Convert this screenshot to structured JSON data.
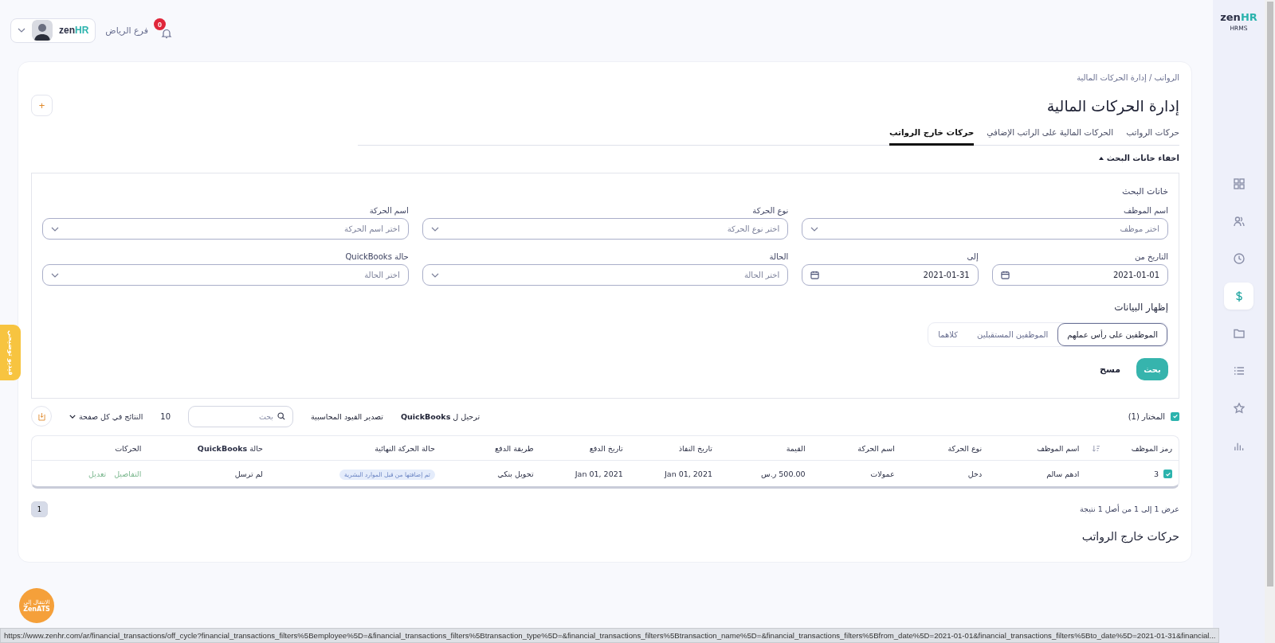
{
  "header": {
    "logo_zen": "zen",
    "logo_hr": "HR",
    "branch": "فرع الرياض",
    "notifications": "0"
  },
  "sidebar": {
    "logo_zen": "zen",
    "logo_hr": "HR",
    "product": "HRMS",
    "items": [
      {
        "kind": "grid",
        "selected": false
      },
      {
        "kind": "users",
        "selected": false
      },
      {
        "kind": "clock",
        "selected": false
      },
      {
        "kind": "dollar",
        "selected": true
      },
      {
        "kind": "folder",
        "selected": false
      },
      {
        "kind": "list",
        "selected": false
      },
      {
        "kind": "star",
        "selected": false
      },
      {
        "kind": "chart",
        "selected": false
      }
    ]
  },
  "breadcrumb": "الرواتب / إدارة الحركات المالية",
  "title": "إدارة الحركات المالية",
  "add_button": "+",
  "tabs": [
    {
      "label": "حركات الرواتب",
      "selected": false
    },
    {
      "label": "الحركات المالية على الراتب الإضافي",
      "selected": false
    },
    {
      "label": "حركات خارج الرواتب",
      "selected": true
    }
  ],
  "search_toggle": "اخفاء خانات البحث",
  "filters": {
    "title": "خانات البحث",
    "fields": [
      {
        "kind": "select",
        "label": "اسم الموظف",
        "placeholder": "اختر موظف"
      },
      {
        "kind": "select",
        "label": "نوع الحركة",
        "placeholder": "اختر نوع الحركة"
      },
      {
        "kind": "select",
        "label": "اسم الحركة",
        "placeholder": "اختر اسم الحركة"
      },
      {
        "kind": "date",
        "label": "التاريخ من",
        "value": "2021-01-01"
      },
      {
        "kind": "date",
        "label": "إلى",
        "value": "2021-01-31"
      },
      {
        "kind": "select",
        "label": "الحالة",
        "placeholder": "اختر الحالة"
      },
      {
        "kind": "select",
        "label": "حالة QuickBooks",
        "placeholder": "اختر الحالة"
      }
    ],
    "show_data": {
      "label": "إظهار البيانات",
      "options": [
        {
          "label": "الموظفين على رأس عملهم",
          "selected": true
        },
        {
          "label": "الموظفين المستقبلين",
          "selected": false
        },
        {
          "label": "كلاهما",
          "selected": false
        }
      ]
    },
    "search_button": "بحث",
    "clear_button": "مسح"
  },
  "toolbar": {
    "selected_label": "المختار (1)",
    "selected_checked": true,
    "post_quickbooks": "ترحيل ل **QuickBooks**",
    "export_entries": "تصدير القيود المحاسبية",
    "search_placeholder": "بحث",
    "per_page": "10",
    "per_page_label": "النتائج في كل صفحة"
  },
  "table": {
    "columns": [
      "رمز الموظف",
      "اسم الموظف",
      "نوع الحركة",
      "اسم الحركة",
      "القيمة",
      "تاريخ النفاذ",
      "تاريخ الدفع",
      "طريقة الدفع",
      "حالة الحركة النهائية",
      "حالة **QuickBooks**",
      "الحركات"
    ],
    "rows": [
      {
        "checked": true,
        "cells": [
          "3",
          "ادهم سالم",
          "دخل",
          "عمولات",
          "500.00 ر.س",
          "Jan 01, 2021",
          "Jan 01, 2021",
          "تحويل بنكي"
        ],
        "status": "تم إضافتها من قبل الموارد البشرية",
        "quickbooks": "لم ترسل",
        "actions": [
          "التفاصيل",
          "تعديل"
        ]
      }
    ]
  },
  "pagination": {
    "pages": [
      {
        "label": "1",
        "selected": true
      }
    ],
    "summary": "عرض 1 إلى 1 من أصل 1 نتيجة"
  },
  "section_title": "حركات خارج الرواتب",
  "video_tab": "فيديو توضيحي",
  "zenats": {
    "line1": "الانتقال إلى",
    "line2": "ZenATS"
  },
  "status_url": "https://www.zenhr.com/ar/financial_transactions/off_cycle?financial_transactions_filters%5Bemployee%5D=&financial_transactions_filters%5Btransaction_type%5D=&financial_transactions_filters%5Btransaction_name%5D=&financial_transactions_filters%5Bfrom_date%5D=2021-01-01&financial_transactions_filters%5Bto_date%5D=2021-01-31&financial..."
}
